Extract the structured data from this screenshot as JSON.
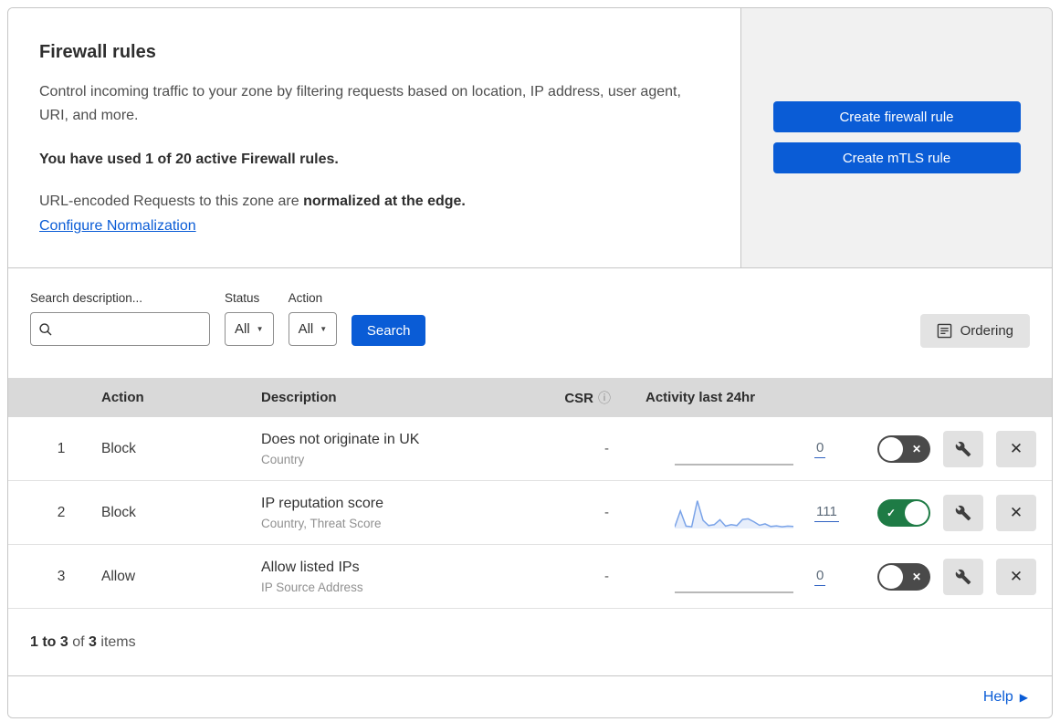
{
  "header": {
    "title": "Firewall rules",
    "description": "Control incoming traffic to your zone by filtering requests based on location, IP address, user agent, URI, and more.",
    "usage_bold": "You have used 1 of 20 active Firewall rules.",
    "normalization_prefix": "URL-encoded Requests to this zone are ",
    "normalization_bold": "normalized at the edge.",
    "normalization_link": "Configure Normalization",
    "buttons": {
      "create_firewall": "Create firewall rule",
      "create_mtls": "Create mTLS rule"
    }
  },
  "toolbar": {
    "search_label": "Search description...",
    "status_label": "Status",
    "status_value": "All",
    "action_label": "Action",
    "action_value": "All",
    "search_button": "Search",
    "ordering_button": "Ordering"
  },
  "table": {
    "columns": {
      "action": "Action",
      "description": "Description",
      "csr": "CSR",
      "activity": "Activity last 24hr"
    },
    "rows": [
      {
        "priority": "1",
        "action": "Block",
        "description": "Does not originate in UK",
        "fields": "Country",
        "csr": "-",
        "count": "0",
        "enabled": false,
        "sparkline": [
          0,
          0
        ]
      },
      {
        "priority": "2",
        "action": "Block",
        "description": "IP reputation score",
        "fields": "Country, Threat Score",
        "csr": "-",
        "count": "111",
        "enabled": true,
        "sparkline": [
          5,
          60,
          8,
          6,
          95,
          28,
          10,
          13,
          30,
          8,
          13,
          10,
          31,
          33,
          23,
          11,
          16,
          7,
          9,
          6,
          8,
          7
        ]
      },
      {
        "priority": "3",
        "action": "Allow",
        "description": "Allow listed IPs",
        "fields": "IP Source Address",
        "csr": "-",
        "count": "0",
        "enabled": false,
        "sparkline": [
          0,
          0
        ]
      }
    ]
  },
  "footer": {
    "range_bold": "1 to 3",
    "of_text": " of ",
    "total_bold": "3",
    "items_text": " items",
    "help_label": "Help"
  },
  "colors": {
    "primary_blue": "#0a5cd6",
    "toggle_on_green": "#1e7b45",
    "toggle_off_gray": "#4a4a4a",
    "spark_line": "#7aa3e8",
    "spark_fill": "rgba(122,163,232,0.18)",
    "spark_flat": "#a0a0a0"
  }
}
